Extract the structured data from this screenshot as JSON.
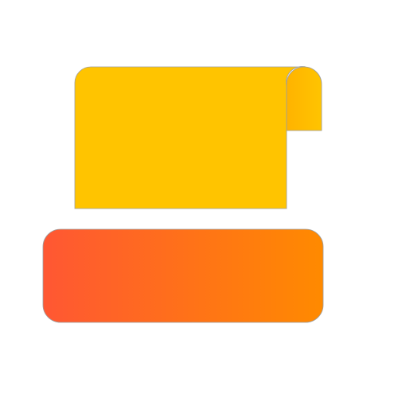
{
  "icon": {
    "name": "app-logo-icon",
    "colors": {
      "top_card": "#FFC400",
      "top_card_fold": "#FFB300",
      "top_card_fold_shadow": "#F59E00",
      "bottom_bar_start": "#FF5733",
      "bottom_bar_end": "#FF8A00",
      "outline": "#9E9E9E"
    }
  }
}
